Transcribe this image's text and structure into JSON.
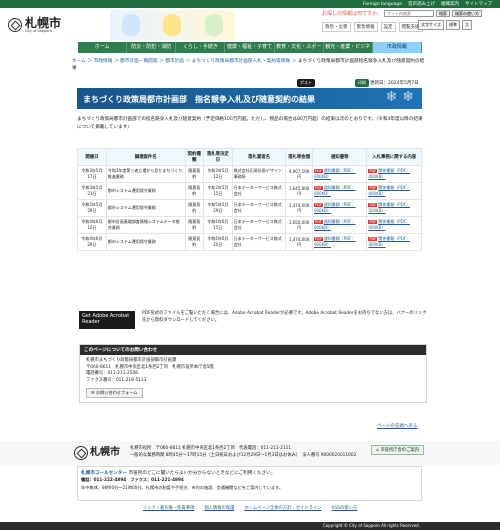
{
  "topbar": {
    "links": [
      "Foreign language",
      "音声読み上げ",
      "組織案内",
      "サイトマップ"
    ]
  },
  "header": {
    "logo_text": "札幌市",
    "logo_sub": "City of Sapporo",
    "info_text": "お探しの情報は何ですか。",
    "search_placeholder": "サイト内検索",
    "search_button": "検索",
    "search_help_button": "検索の使い方",
    "icons": [
      "救急・災害",
      "緊急情報",
      "設定",
      "閲覧支援"
    ],
    "size_buttons": [
      "文字サイズ",
      "標準",
      "大"
    ]
  },
  "nav": {
    "items": [
      "ホーム",
      "防災・防犯・消防",
      "くらし・手続き",
      "健康・福祉・子育て",
      "教育・文化・スポーツ",
      "観光・産業・ビジネス",
      "市政情報"
    ]
  },
  "breadcrumb": {
    "items": [
      "ホーム",
      "市政情報",
      "都市計画・再開発",
      "都市計画",
      "まちづくり政策局都市計画部入札・契約等情報",
      "まちづくり政策局都市計画部指名競争入札及び随意契約の結果"
    ]
  },
  "actions": {
    "tweet": "ポスト",
    "print": "印刷",
    "updated": "更新日：2024年5月7日"
  },
  "page": {
    "title": "まちづくり政策局都市計画部　指名競争入札及び随意契約の結果",
    "intro": "まちづくり政策局都市計画部での指名競争入札及び随意契約（予定価格100万円超。ただし、物品の場合は80万円超）の結果は次のとおりです。（令和4年度以降の結果について掲載しています）"
  },
  "table": {
    "headers": [
      "開催日",
      "調達案件名",
      "契約種類",
      "落札等決定日",
      "落札業者名",
      "落札等金額",
      "通知書等",
      "入札事務に関する内容"
    ],
    "rows": [
      {
        "date": "令和3年5月17日",
        "item": "令和3年度第三者立場から見たまちづくり推進業務",
        "type": "随意契約",
        "decide": "令和3年5月12日",
        "vendor": "株式会社石塚計画デザイン事務所",
        "amount": "4,907,100円",
        "notice": "通知書類（PDF：000KB）",
        "related": "関係書類（PDF：000KB）"
      },
      {
        "date": "令和3年5月21日",
        "item": "都市システム運用保守業務",
        "type": "随意契約",
        "decide": "令和3年5月15日",
        "vendor": "日本データーサービス株式会社",
        "amount": "1,645,900円",
        "notice": "通知書類（PDF：000KB）",
        "related": "関係書類（PDF：000KB）"
      },
      {
        "date": "令和5年5月29日",
        "item": "都市システム運用保守業務",
        "type": "随意契約",
        "decide": "令和5年5月29日",
        "vendor": "日本データーサービス株式会社",
        "amount": "1,474,000円",
        "notice": "通知書類（PDF：000KB）",
        "related": "関係書類（PDF：000KB）"
      },
      {
        "date": "令和4年6月10日",
        "item": "都市計画基礎調査情報システムデータ統合業務",
        "type": "随意契約",
        "decide": "令和4年6月15日",
        "vendor": "日本データーサービス株式会社",
        "amount": "3,650,000円",
        "notice": "通知書類（PDF：000KB）",
        "related": "関係書類（PDF：000KB）"
      },
      {
        "date": "令和4年6月29日",
        "item": "都市システム運用保守業務",
        "type": "随意契約",
        "decide": "令和4年6月20日",
        "vendor": "日本データーサービス株式会社",
        "amount": "1,474,000円",
        "notice": "通知書類（PDF：000KB）",
        "related": "関係書類（PDF：000KB）"
      }
    ]
  },
  "adobe": {
    "badge": "Get Adobe Acrobat Reader",
    "text": "PDF形式のファイルをご覧いただく場合には、Adobe Acrobat Readerが必要です。Adobe Acrobat Readerをお持ちでない方は、バナーのリンク先から無料ダウンロードしてください。"
  },
  "contact": {
    "heading": "このページについてのお問い合わせ",
    "lines": [
      "札幌市まちづくり政策局都市計画部都市計画課",
      "〒060-8611　札幌市中央区北1条西2丁目　札幌市役所本庁舎5階",
      "電話番号：011-211-2506",
      "ファクス番号：011-218-5113"
    ],
    "button": "お問い合わせフォーム"
  },
  "totop": "ページの先頭へ戻る",
  "footer": {
    "logo_text": "札幌市",
    "address": "札幌市役所　〒060-8611 札幌市中央区北1条西2丁目　代表電話：011-211-2111",
    "address2": "一般的な業務時間 8時45分～17時15分（土日祝日および12月29日～1月3日はお休み）　法人番号 9000020011002",
    "map_button": "市役所庁舎のご案内",
    "call_title": "札幌市コールセンター",
    "call_note": "市役所のどこに聞いたらよいか分からないときなどにご利用ください。",
    "call_tel": "電話：011-222-4894　ファクス：011-221-4894",
    "call_hours": "年中無休、8時00分～21時00分。札幌市の制度や手続き、市内の施設、交通機関などをご案内しています。",
    "links": [
      "リンク・著作権・免責事項",
      "個人情報の保護",
      "ホームページ全体の方針・ガイドライン",
      "RSSの使い方"
    ],
    "copyright": "Copyright © City of Sapporo All rights Reserved."
  }
}
